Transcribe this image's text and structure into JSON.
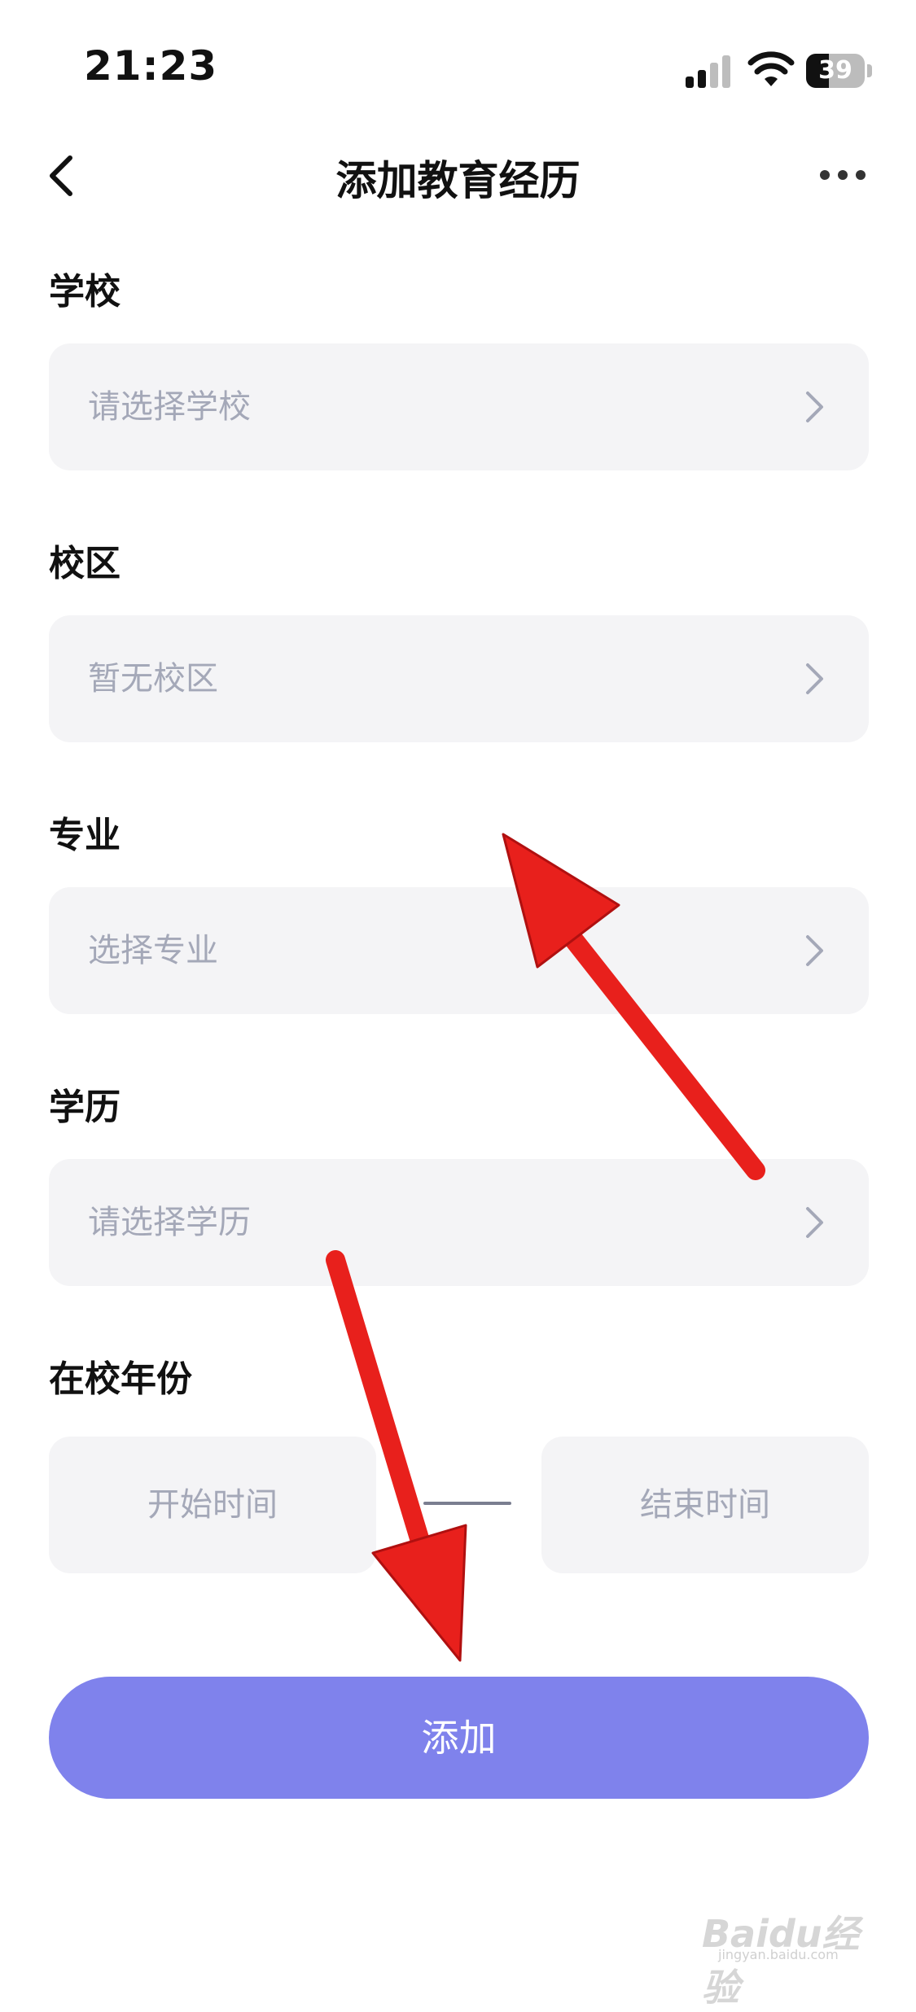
{
  "status_bar": {
    "time": "21:23",
    "battery_percent": "39",
    "battery_level": 0.39,
    "icons": [
      "signal-icon",
      "wifi-icon",
      "battery-icon"
    ]
  },
  "nav": {
    "title": "添加教育经历",
    "back_icon": "chevron-left-icon",
    "more_icon": "more-dots-icon"
  },
  "form": {
    "school": {
      "label": "学校",
      "placeholder": "请选择学校"
    },
    "campus": {
      "label": "校区",
      "placeholder": "暂无校区"
    },
    "major": {
      "label": "专业",
      "placeholder": "选择专业"
    },
    "degree": {
      "label": "学历",
      "placeholder": "请选择学历"
    },
    "years": {
      "label": "在校年份",
      "start_placeholder": "开始时间",
      "end_placeholder": "结束时间"
    }
  },
  "submit_label": "添加",
  "colors": {
    "accent": "#7f82ec",
    "field_bg": "#f4f4f6",
    "placeholder": "#a4a8b8",
    "annotation_arrow": "#e8201c"
  },
  "watermark": {
    "brand": "Baidu经验",
    "url": "jingyan.baidu.com"
  }
}
